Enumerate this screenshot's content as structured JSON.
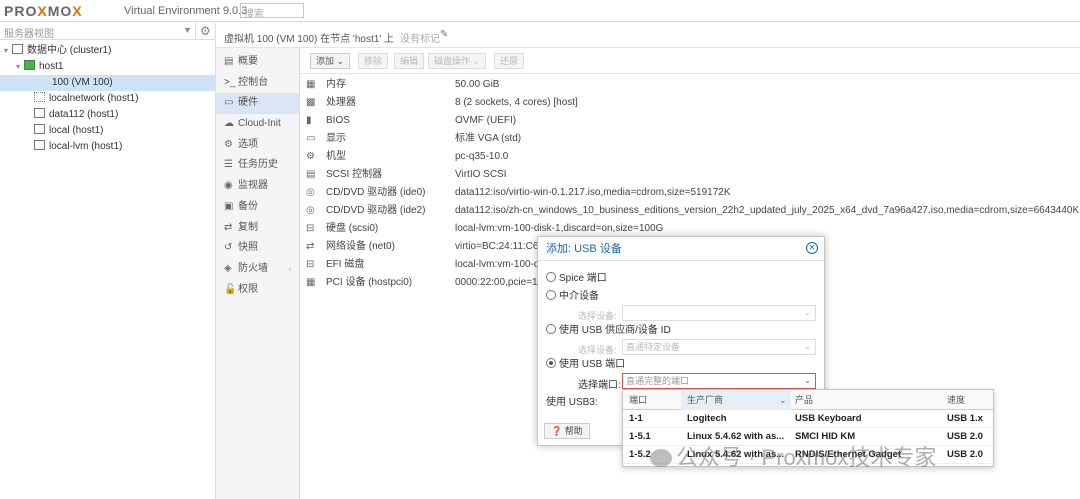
{
  "topbar": {
    "logo_pro": "PRO",
    "logo_x": "X",
    "logo_mo": "MO",
    "logo_x2": "X",
    "version": "Virtual Environment 9.0.3",
    "search_placeholder": "搜索"
  },
  "tree": {
    "view": "服务器视图",
    "items": [
      {
        "label": "数据中心 (cluster1)"
      },
      {
        "label": "host1"
      },
      {
        "label": "100 (VM 100)"
      },
      {
        "label": "localnetwork (host1)"
      },
      {
        "label": "data112 (host1)"
      },
      {
        "label": "local (host1)"
      },
      {
        "label": "local-lvm (host1)"
      }
    ]
  },
  "header": {
    "title": "虚拟机 100 (VM 100) 在节点 'host1' 上",
    "tags": "没有标记"
  },
  "nav": {
    "items": [
      {
        "label": "概要"
      },
      {
        "label": ">_ 控制台"
      },
      {
        "label": "硬件"
      },
      {
        "label": "Cloud-Init"
      },
      {
        "label": "选项"
      },
      {
        "label": "任务历史"
      },
      {
        "label": "监视器"
      },
      {
        "label": "备份"
      },
      {
        "label": "复制"
      },
      {
        "label": "快照"
      },
      {
        "label": "防火墙"
      },
      {
        "label": "权限"
      }
    ]
  },
  "toolbar": {
    "add": "添加",
    "remove": "移除",
    "edit": "编辑",
    "disk_action": "磁盘操作",
    "revert": "还原"
  },
  "hardware": [
    {
      "name": "内存",
      "value": "50.00 GiB"
    },
    {
      "name": "处理器",
      "value": "8 (2 sockets, 4 cores) [host]"
    },
    {
      "name": "BIOS",
      "value": "OVMF (UEFI)"
    },
    {
      "name": "显示",
      "value": "标准 VGA (std)"
    },
    {
      "name": "机型",
      "value": "pc-q35-10.0"
    },
    {
      "name": "SCSI 控制器",
      "value": "VirtIO SCSI"
    },
    {
      "name": "CD/DVD 驱动器 (ide0)",
      "value": "data112:iso/virtio-win-0.1.217.iso,media=cdrom,size=519172K"
    },
    {
      "name": "CD/DVD 驱动器 (ide2)",
      "value": "data112:iso/zh-cn_windows_10_business_editions_version_22h2_updated_july_2025_x64_dvd_7a96a427.iso,media=cdrom,size=6643440K"
    },
    {
      "name": "硬盘 (scsi0)",
      "value": "local-lvm:vm-100-disk-1,discard=on,size=100G"
    },
    {
      "name": "网络设备 (net0)",
      "value": "virtio=BC:24:11:C6"
    },
    {
      "name": "EFI 磁盘",
      "value": "local-lvm:vm-100-di"
    },
    {
      "name": "PCI 设备 (hostpci0)",
      "value": "0000:22:00,pcie=1"
    }
  ],
  "dialog": {
    "title": "添加: USB 设备",
    "opt_spice": "Spice 端口",
    "opt_mapped": "中介设备",
    "lbl_select_device": "选择设备:",
    "opt_vendor": "使用 USB 供应商/设备 ID",
    "placeholder_device": "直通特定设备",
    "opt_port": "使用 USB 端口",
    "lbl_select_port": "选择端口:",
    "placeholder_port": "直通完整的端口",
    "lbl_usb3": "使用 USB3:",
    "help": "帮助"
  },
  "grid": {
    "columns": [
      "端口",
      "生产厂商",
      "产品",
      "速度"
    ],
    "rows": [
      {
        "port": "1-1",
        "vendor": "Logitech",
        "product": "USB Keyboard",
        "speed": "USB 1.x"
      },
      {
        "port": "1-5.1",
        "vendor": "Linux 5.4.62 with as...",
        "product": "SMCI HID KM",
        "speed": "USB 2.0"
      },
      {
        "port": "1-5.2",
        "vendor": "Linux 5.4.62 with as...",
        "product": "RNDIS/Ethernet Gadget",
        "speed": "USB 2.0"
      }
    ]
  },
  "watermark": "公众号 · Proxmox技术专家"
}
